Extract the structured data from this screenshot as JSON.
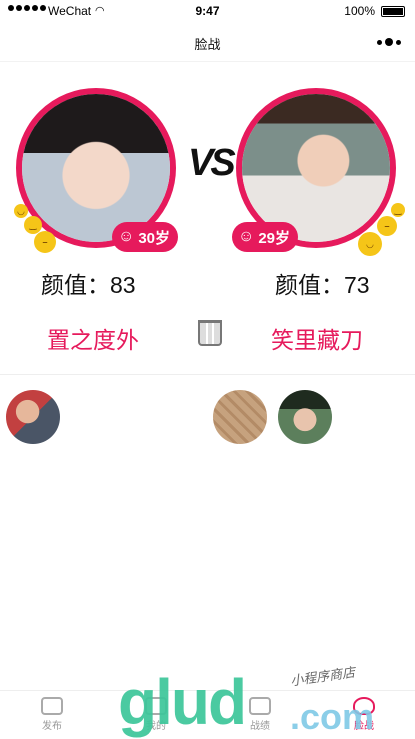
{
  "status": {
    "carrier": "WeChat",
    "time": "9:47",
    "battery": "100%"
  },
  "nav": {
    "title": "脸战"
  },
  "left": {
    "age": "30岁",
    "score_label": "颜值：",
    "score": "83",
    "verdict": "置之度外"
  },
  "right": {
    "age": "29岁",
    "score_label": "颜值：",
    "score": "73",
    "verdict": "笑里藏刀"
  },
  "vs": "VS",
  "tabs": [
    {
      "label": "发布"
    },
    {
      "label": "我的"
    },
    {
      "label": "战绩"
    },
    {
      "label": "脸战"
    }
  ],
  "watermark": {
    "brand": "glud",
    "tld": ".com",
    "tagline": "小程序商店"
  },
  "colors": {
    "accent": "#e61a5c"
  }
}
